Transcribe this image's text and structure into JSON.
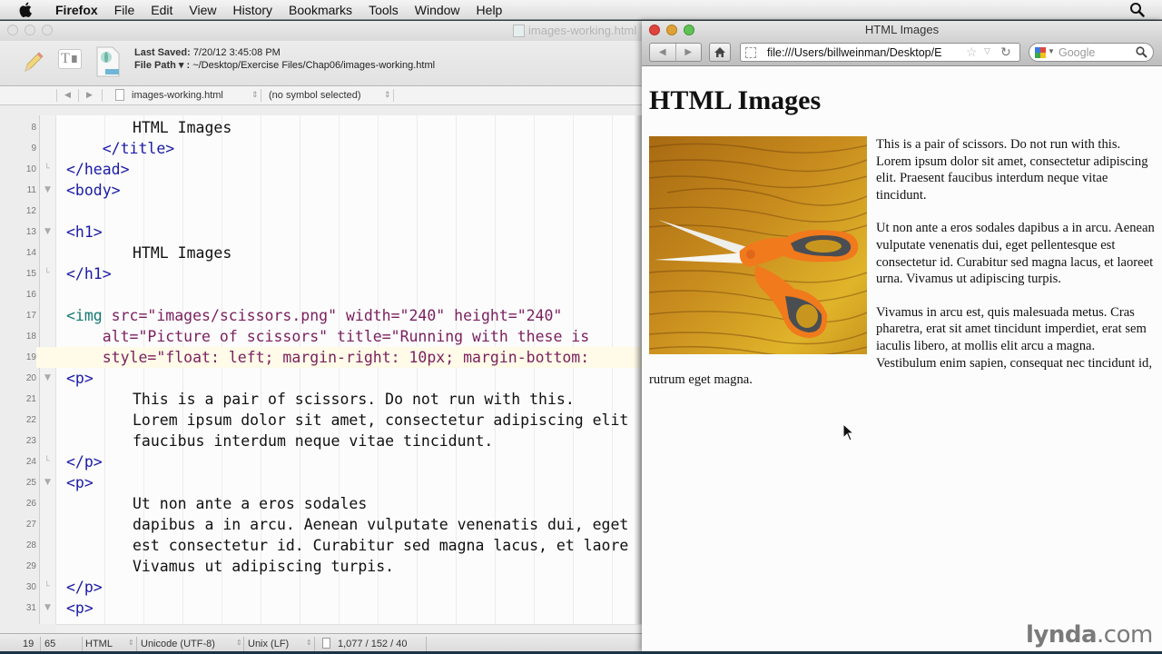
{
  "menubar": {
    "app_name": "Firefox",
    "items": [
      "File",
      "Edit",
      "View",
      "History",
      "Bookmarks",
      "Tools",
      "Window",
      "Help"
    ]
  },
  "editor": {
    "window_title": "images-working.html",
    "last_saved_label": "Last Saved:",
    "last_saved_value": "7/20/12 3:45:08 PM",
    "file_path_label": "File Path ▾ :",
    "file_path_value": "~/Desktop/Exercise Files/Chap06/images-working.html",
    "nav_file": "images-working.html",
    "nav_symbol": "(no symbol selected)",
    "lines": [
      {
        "n": "8",
        "fold": "",
        "indent": "        ",
        "parts": [
          {
            "c": "tx",
            "t": "HTML Images"
          }
        ]
      },
      {
        "n": "9",
        "fold": "",
        "indent": "    ",
        "parts": [
          {
            "c": "tag",
            "t": "</title>"
          }
        ]
      },
      {
        "n": "10",
        "fold": "end",
        "indent": "",
        "parts": [
          {
            "c": "tag",
            "t": "</head>"
          }
        ]
      },
      {
        "n": "11",
        "fold": "open",
        "indent": "",
        "parts": [
          {
            "c": "tag",
            "t": "<body>"
          }
        ]
      },
      {
        "n": "12",
        "fold": "",
        "indent": "",
        "parts": []
      },
      {
        "n": "13",
        "fold": "open",
        "indent": "",
        "parts": [
          {
            "c": "tag",
            "t": "<h1>"
          }
        ]
      },
      {
        "n": "14",
        "fold": "",
        "indent": "    ",
        "parts": [
          {
            "c": "tx",
            "t": "HTML Images"
          }
        ]
      },
      {
        "n": "15",
        "fold": "end",
        "indent": "",
        "parts": [
          {
            "c": "tag",
            "t": "</h1>"
          }
        ]
      },
      {
        "n": "16",
        "fold": "",
        "indent": "",
        "parts": []
      },
      {
        "n": "17",
        "fold": "",
        "indent": "",
        "parts": [
          {
            "c": "tag2",
            "t": "<img "
          },
          {
            "c": "attr",
            "t": "src=\"images/scissors.png\" width=\"240\" height=\"240\""
          }
        ]
      },
      {
        "n": "18",
        "fold": "",
        "indent": "    ",
        "parts": [
          {
            "c": "attr",
            "t": "alt=\"Picture of scissors\" title=\"Running with these is"
          }
        ]
      },
      {
        "n": "19",
        "fold": "",
        "indent": "    ",
        "hl": true,
        "parts": [
          {
            "c": "attr",
            "t": "style=\"float: left; margin-right: 10px; margin-bottom:"
          }
        ]
      },
      {
        "n": "20",
        "fold": "open",
        "indent": "",
        "parts": [
          {
            "c": "tag",
            "t": "<p>"
          }
        ]
      },
      {
        "n": "21",
        "fold": "",
        "indent": "    ",
        "parts": [
          {
            "c": "tx",
            "t": "This is a pair of scissors. Do not run with this."
          }
        ]
      },
      {
        "n": "22",
        "fold": "",
        "indent": "    ",
        "parts": [
          {
            "c": "tx",
            "t": "Lorem ipsum dolor sit amet, consectetur adipiscing elit"
          }
        ]
      },
      {
        "n": "23",
        "fold": "",
        "indent": "    ",
        "parts": [
          {
            "c": "tx",
            "t": "faucibus interdum neque vitae tincidunt."
          }
        ]
      },
      {
        "n": "24",
        "fold": "end",
        "indent": "",
        "parts": [
          {
            "c": "tag",
            "t": "</p>"
          }
        ]
      },
      {
        "n": "25",
        "fold": "open",
        "indent": "",
        "parts": [
          {
            "c": "tag",
            "t": "<p>"
          }
        ]
      },
      {
        "n": "26",
        "fold": "",
        "indent": "    ",
        "parts": [
          {
            "c": "tx",
            "t": "Ut non ante a eros sodales"
          }
        ]
      },
      {
        "n": "27",
        "fold": "",
        "indent": "    ",
        "parts": [
          {
            "c": "tx",
            "t": "dapibus a in arcu. Aenean vulputate venenatis dui, eget"
          }
        ]
      },
      {
        "n": "28",
        "fold": "",
        "indent": "    ",
        "parts": [
          {
            "c": "tx",
            "t": "est consectetur id. Curabitur sed magna lacus, et laore"
          }
        ]
      },
      {
        "n": "29",
        "fold": "",
        "indent": "    ",
        "parts": [
          {
            "c": "tx",
            "t": "Vivamus ut adipiscing turpis."
          }
        ]
      },
      {
        "n": "30",
        "fold": "end",
        "indent": "",
        "parts": [
          {
            "c": "tag",
            "t": "</p>"
          }
        ]
      },
      {
        "n": "31",
        "fold": "open",
        "indent": "",
        "parts": [
          {
            "c": "tag",
            "t": "<p>"
          }
        ]
      }
    ],
    "status": {
      "line": "19",
      "column": "65",
      "language": "HTML",
      "encoding": "Unicode (UTF-8)",
      "line_endings": "Unix (LF)",
      "counts": "1,077 / 152 / 40"
    }
  },
  "browser": {
    "window_title": "HTML Images",
    "url": "file:///Users/billweinman/Desktop/E",
    "search_placeholder": "Google",
    "page": {
      "heading": "HTML Images",
      "image_alt": "Picture of scissors",
      "paragraphs": [
        "This is a pair of scissors. Do not run with this. Lorem ipsum dolor sit amet, consectetur adipiscing elit. Praesent faucibus interdum neque vitae tincidunt.",
        "Ut non ante a eros sodales dapibus a in arcu. Aenean vulputate venenatis dui, eget pellentesque est consectetur id. Curabitur sed magna lacus, et laoreet urna. Vivamus ut adipiscing turpis.",
        "Vivamus in arcu est, quis malesuada metus. Cras pharetra, erat sit amet tincidunt imperdiet, erat sem iaculis libero, at mollis elit arcu a magna. Vestibulum enim sapien, consequat nec tincidunt id, rutrum eget magna."
      ]
    }
  },
  "watermark": {
    "brand": "lynda",
    "suffix": ".com"
  }
}
